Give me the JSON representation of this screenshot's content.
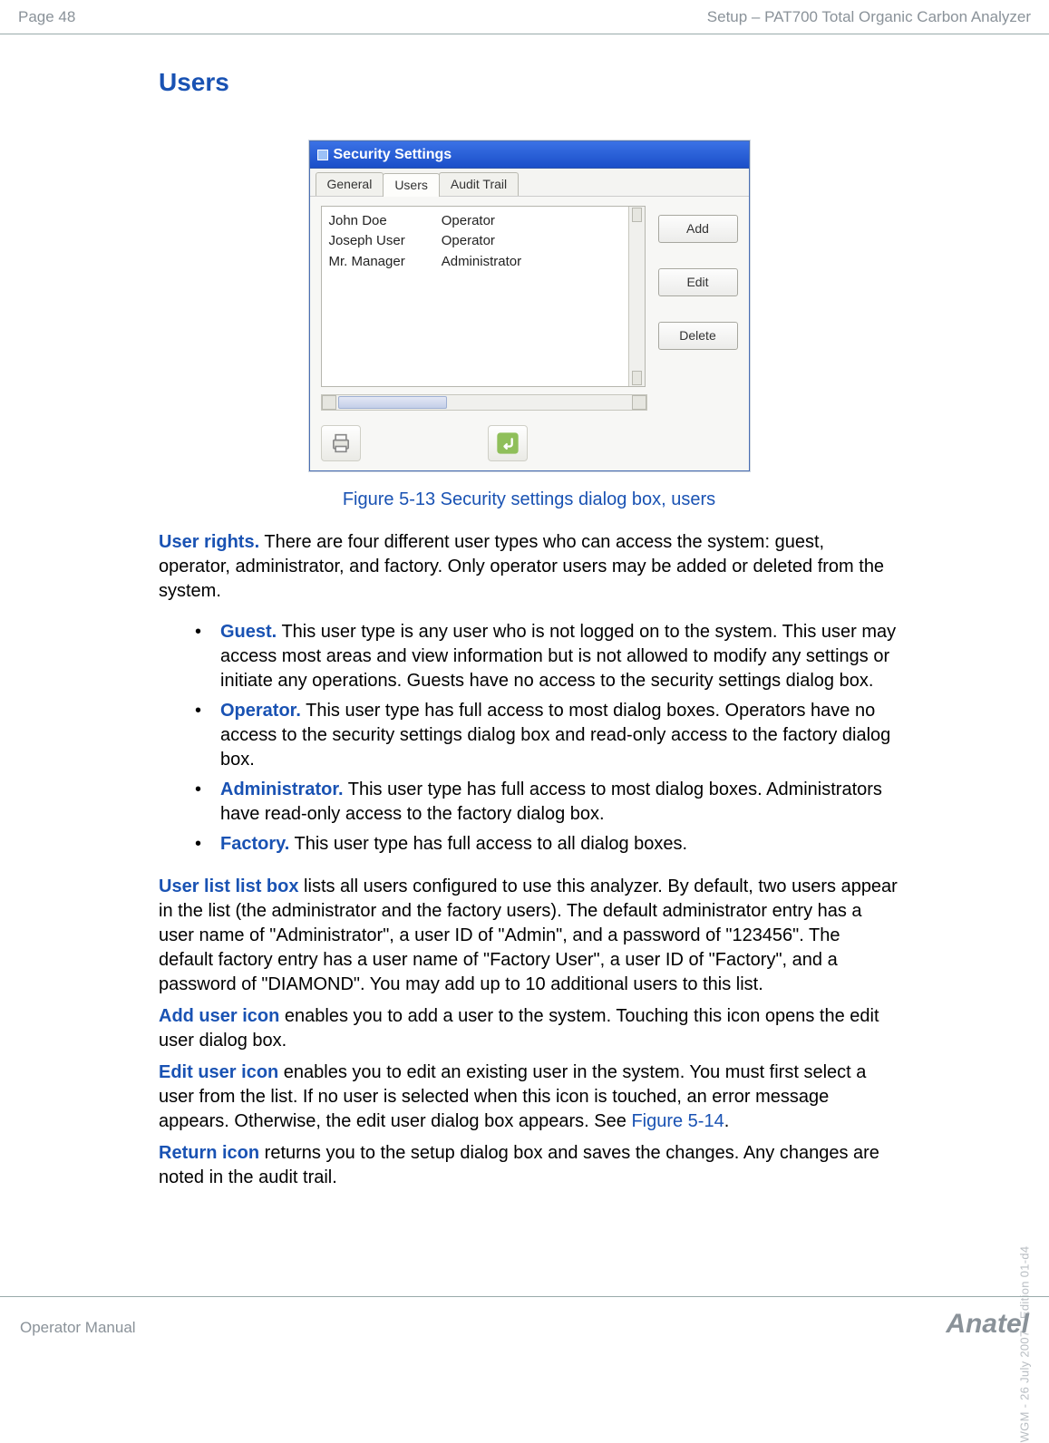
{
  "header": {
    "page_number": "Page 48",
    "doc_title": "Setup – PAT700 Total Organic Carbon Analyzer"
  },
  "section_heading": "Users",
  "dialog": {
    "title": "Security Settings",
    "tabs": [
      "General",
      "Users",
      "Audit Trail"
    ],
    "active_tab_index": 1,
    "list": {
      "names": [
        "John Doe",
        "Joseph User",
        "Mr. Manager"
      ],
      "roles": [
        "Operator",
        "Operator",
        "Administrator"
      ]
    },
    "buttons": {
      "add": "Add",
      "edit": "Edit",
      "delete": "Delete"
    }
  },
  "figure_caption": "Figure 5-13 Security settings dialog box, users",
  "paragraphs": {
    "user_rights_label": "User rights.",
    "user_rights_text": " There are four different user types who can access the system: guest, operator, administrator, and factory. Only operator users may be added or deleted from the system.",
    "bullets": [
      {
        "label": "Guest.",
        "text": " This user type is any user who is not logged on to the system. This user may access most areas and view information but is not allowed to modify any settings or initiate any operations. Guests have no access to the security settings dialog box."
      },
      {
        "label": "Operator.",
        "text": " This user type has full access to most dialog boxes. Operators have no access to the security settings dialog box and read-only access to the factory dialog box."
      },
      {
        "label": "Administrator.",
        "text": " This user type has full access to most dialog boxes. Administrators have read-only access to the factory dialog box."
      },
      {
        "label": "Factory.",
        "text": " This user type has full access to all dialog boxes."
      }
    ],
    "user_list_label": "User list list box",
    "user_list_text": " lists all users configured to use this analyzer. By default, two users appear in the list (the administrator and the factory users). The default administrator entry has a user name of \"Administrator\", a user ID of \"Admin\", and a password of \"123456\". The default factory entry has a user name of \"Factory User\", a user ID of \"Factory\", and a password of \"DIAMOND\". You may add up to 10 additional users to this list.",
    "add_icon_label": "Add user icon",
    "add_icon_text": " enables you to add a user to the system. Touching this icon opens the edit user dialog box.",
    "edit_icon_label": "Edit user icon",
    "edit_icon_text_a": " enables you to edit an existing user in the system. You must first select a user from the list. If no user is selected when this icon is touched, an error message appears. Otherwise, the edit user dialog box appears. See ",
    "edit_icon_link": "Figure 5-14",
    "edit_icon_text_b": ".",
    "return_icon_label": "Return icon",
    "return_icon_text": " returns you to the setup dialog box and saves the changes. Any changes are noted in the audit trail."
  },
  "side_stamp": "WGM - 26 July 2007 - Edition 01-d4",
  "footer": {
    "left": "Operator Manual",
    "brand": "Anatel"
  }
}
